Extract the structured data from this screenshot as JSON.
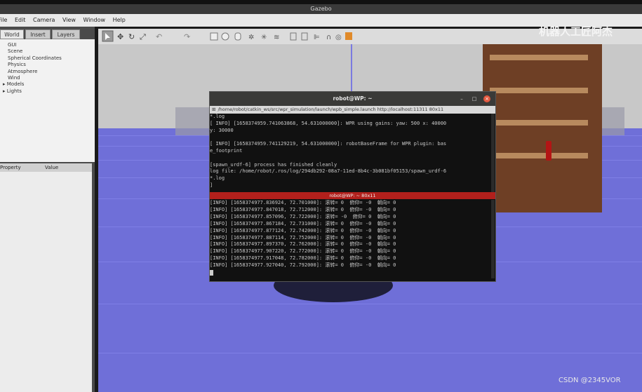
{
  "app": {
    "title": "Gazebo"
  },
  "menu": [
    "File",
    "Edit",
    "Camera",
    "View",
    "Window",
    "Help"
  ],
  "left_tabs": [
    "World",
    "Insert",
    "Layers"
  ],
  "tree_items": [
    "GUI",
    "Scene",
    "Spherical Coordinates",
    "Physics",
    "Atmosphere",
    "Wind",
    "Models",
    "Lights"
  ],
  "properties": {
    "col_property": "Property",
    "col_value": "Value"
  },
  "watermark": {
    "top": "机器人工匠阿杰",
    "bottom": "CSDN @2345VOR"
  },
  "terminal": {
    "title": "robot@WP: ~",
    "path": "/home/robot/catkin_ws/src/wpr_simulation/launch/wpb_simple.launch http://localhost:11311 80x11",
    "pane1_lines": [
      "*.log",
      "[ INFO] [1658374959.741063868, 54.631000000]: WPR using gains: yaw: 500 x: 40000",
      " y: 30000",
      "",
      "[ INFO] [1658374959.741129219, 54.631000000]: robotBaseFrame for WPR plugin: bas",
      "e_footprint",
      "",
      "[spawn_urdf-6] process has finished cleanly",
      "log file: /home/robot/.ros/log/294db292-08a7-11ed-8b4c-3b081bf05153/spawn_urdf-6",
      "*.log",
      "]"
    ],
    "pane2_title": "robot@WP: ~ 80x11",
    "pane2_lines": [
      "[INFO] [1658374977.836924, 72.701000]: 滚转= 0  俯仰= -0  朝向= 0",
      "[INFO] [1658374977.847018, 72.712000]: 滚转= 0  俯仰= -0  朝向= 0",
      "[INFO] [1658374977.857096, 72.722000]: 滚转= -0  俯仰= 0  朝向= 0",
      "[INFO] [1658374977.867184, 72.731000]: 滚转= 0  俯仰= -0  朝向= 0",
      "[INFO] [1658374977.877124, 72.742000]: 滚转= 0  俯仰= -0  朝向= 0",
      "[INFO] [1658374977.887114, 72.752000]: 滚转= 0  俯仰= -0  朝向= 0",
      "[INFO] [1658374977.897370, 72.762000]: 滚转= 0  俯仰= -0  朝向= 0",
      "[INFO] [1658374977.907220, 72.772000]: 滚转= 0  俯仰= -0  朝向= 0",
      "[INFO] [1658374977.917048, 72.782000]: 滚转= 0  俯仰= -0  朝向= 0",
      "[INFO] [1658374977.927040, 72.792000]: 滚转= 0  俯仰= -0  朝向= 0"
    ]
  }
}
